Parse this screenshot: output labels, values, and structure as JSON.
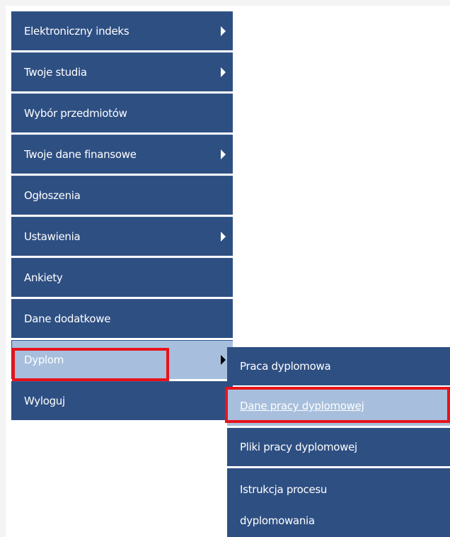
{
  "menu": {
    "items": [
      {
        "label": "Elektroniczny indeks",
        "has_submenu": true
      },
      {
        "label": "Twoje studia",
        "has_submenu": true
      },
      {
        "label": "Wybór przedmiotów",
        "has_submenu": false
      },
      {
        "label": "Twoje dane finansowe",
        "has_submenu": true
      },
      {
        "label": "Ogłoszenia",
        "has_submenu": false
      },
      {
        "label": "Ustawienia",
        "has_submenu": true
      },
      {
        "label": "Ankiety",
        "has_submenu": false
      },
      {
        "label": "Dane dodatkowe",
        "has_submenu": false
      },
      {
        "label": "Dyplom",
        "has_submenu": true,
        "active": true
      },
      {
        "label": "Wyloguj",
        "has_submenu": false
      }
    ]
  },
  "submenu": {
    "items": [
      {
        "label": "Praca dyplomowa"
      },
      {
        "label": "Dane pracy dyplomowej",
        "active": true
      },
      {
        "label": "Pliki pracy dyplomowej"
      },
      {
        "label_line1": "Istrukcja procesu",
        "label_line2": "dyplomowania"
      }
    ]
  },
  "colors": {
    "menu_bg": "#2e4f82",
    "active_bg": "#a7bfdc",
    "highlight_border": "#e8131a"
  },
  "icons": {
    "submenu_arrow": "triangle-right"
  }
}
